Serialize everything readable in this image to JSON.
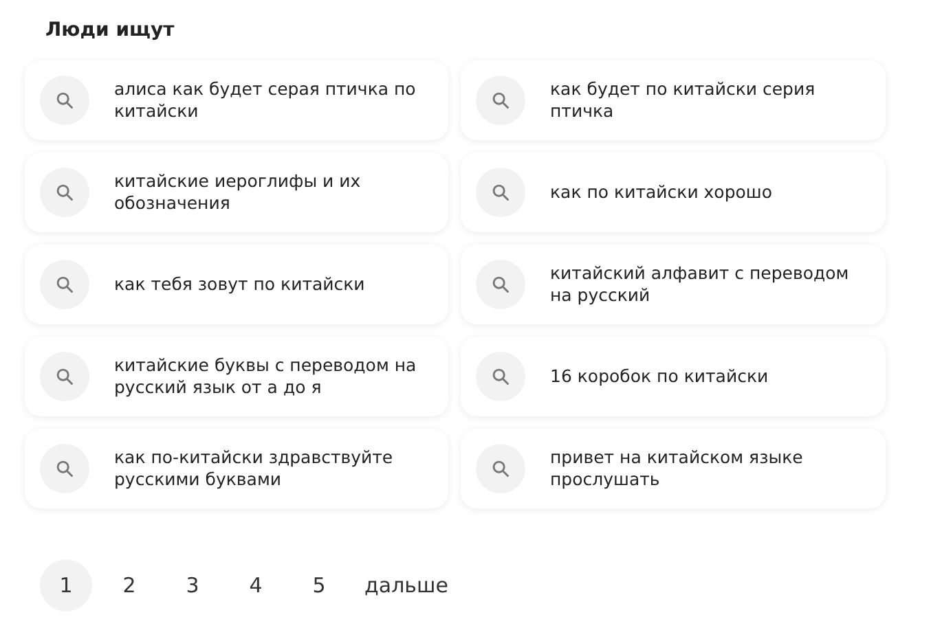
{
  "title": "Люди ищут",
  "suggestions": [
    {
      "text": "алиса как будет серая птичка по китайски"
    },
    {
      "text": "как будет по китайски серия птичка"
    },
    {
      "text": "китайские иероглифы и их обозначения"
    },
    {
      "text": "как по китайски хорошо"
    },
    {
      "text": "как тебя зовут по китайски"
    },
    {
      "text": "китайский алфавит с переводом на русский"
    },
    {
      "text": "китайские буквы с переводом на русский язык от а до я"
    },
    {
      "text": "16 коробок по китайски"
    },
    {
      "text": "как по-китайски здравствуйте русскими буквами"
    },
    {
      "text": "привет на китайском языке прослушать"
    }
  ],
  "pagination": {
    "pages": [
      {
        "label": "1",
        "selected": true
      },
      {
        "label": "2",
        "selected": false
      },
      {
        "label": "3",
        "selected": false
      },
      {
        "label": "4",
        "selected": false
      },
      {
        "label": "5",
        "selected": false
      }
    ],
    "next": "дальше"
  }
}
